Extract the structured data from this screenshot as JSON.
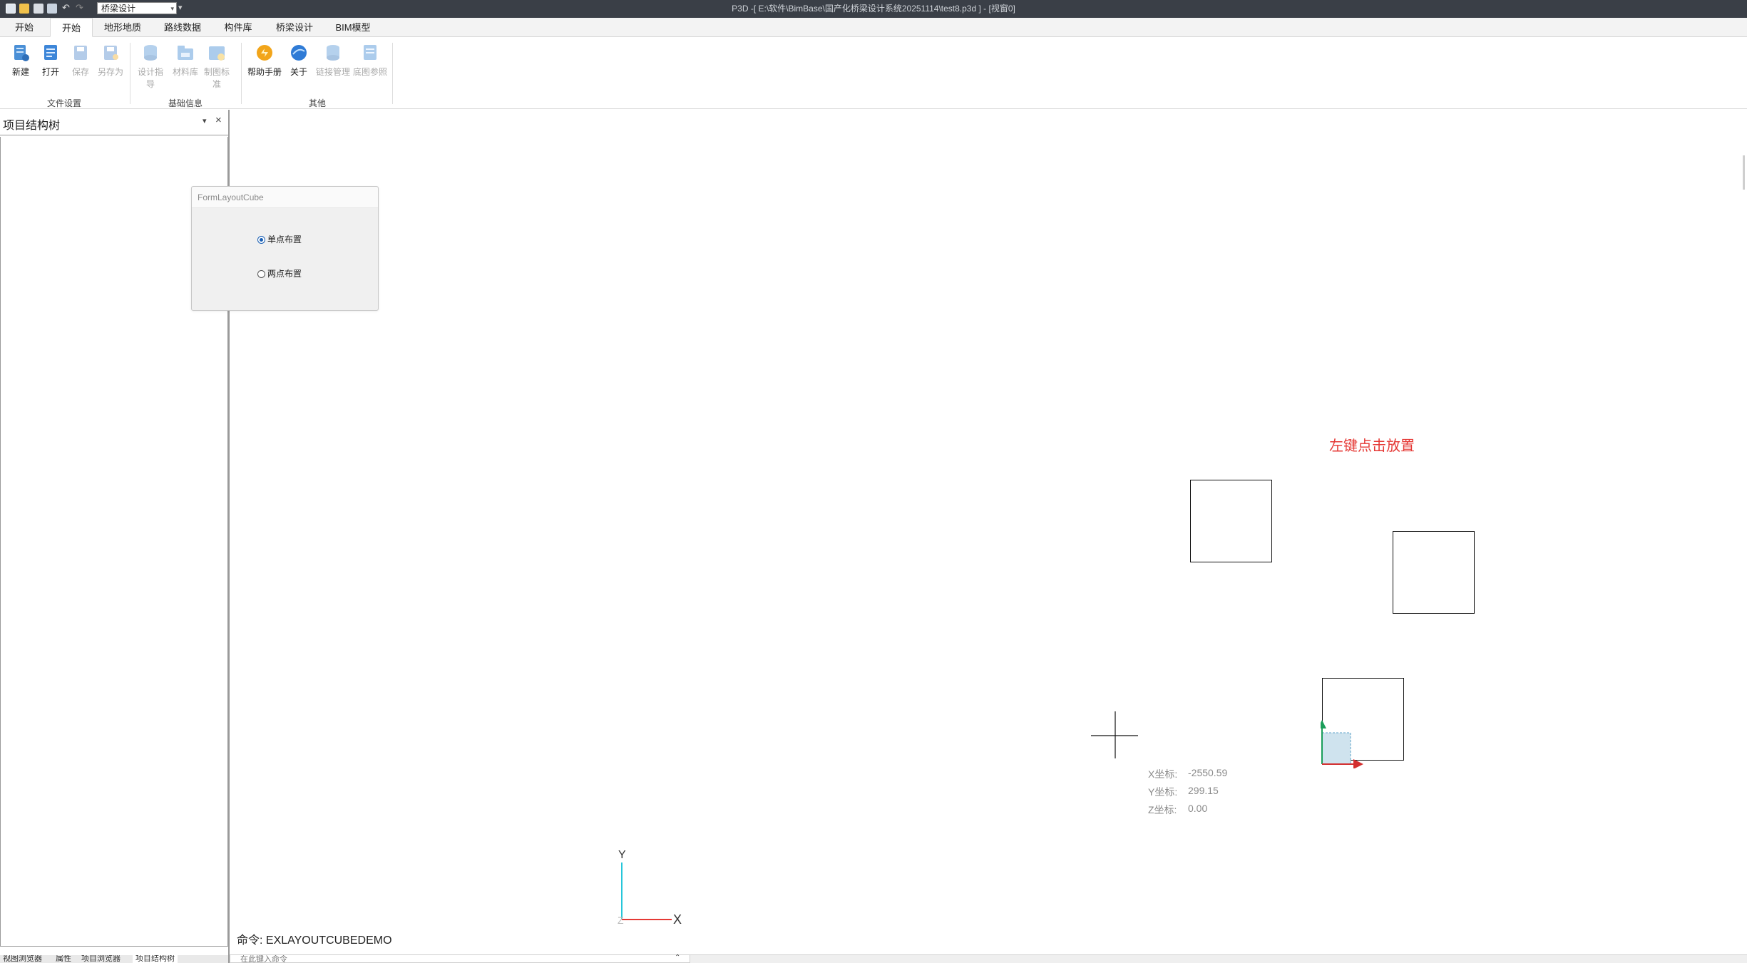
{
  "window": {
    "title": "P3D -[ E:\\软件\\BimBase\\国产化桥梁设计系统20251114\\test8.p3d ] - [视窗0]"
  },
  "quick_access": {
    "icons": [
      "new-file-icon",
      "open-folder-icon",
      "save-icon",
      "save-as-icon",
      "undo-icon",
      "redo-icon"
    ],
    "workspace_value": "桥梁设计",
    "more_symbol": "▾"
  },
  "ribbon": {
    "tabs": [
      {
        "label": "开始",
        "active": false
      },
      {
        "label": "开始",
        "active": true
      },
      {
        "label": "地形地质",
        "active": false
      },
      {
        "label": "路线数据",
        "active": false
      },
      {
        "label": "构件库",
        "active": false
      },
      {
        "label": "桥梁设计",
        "active": false
      },
      {
        "label": "BIM模型",
        "active": false
      }
    ],
    "groups": [
      {
        "label": "文件设置"
      },
      {
        "label": "基础信息"
      },
      {
        "label": "其他"
      }
    ],
    "buttons": [
      {
        "label": "新建",
        "icon": "new-document-icon",
        "enabled": true
      },
      {
        "label": "打开",
        "icon": "open-document-icon",
        "enabled": true
      },
      {
        "label": "保存",
        "icon": "save-icon",
        "enabled": false
      },
      {
        "label": "另存为",
        "icon": "save-as-icon",
        "enabled": false
      },
      {
        "label": "设计指导",
        "icon": "design-guide-icon",
        "enabled": false
      },
      {
        "label": "材料库",
        "icon": "material-library-icon",
        "enabled": false
      },
      {
        "label": "制图标准",
        "icon": "drawing-standard-icon",
        "enabled": false
      },
      {
        "label": "帮助手册",
        "icon": "help-manual-icon",
        "enabled": true
      },
      {
        "label": "关于",
        "icon": "about-icon",
        "enabled": true
      },
      {
        "label": "链接管理",
        "icon": "link-manager-icon",
        "enabled": false
      },
      {
        "label": "底图参照",
        "icon": "base-map-reference-icon",
        "enabled": false
      }
    ]
  },
  "left_panel": {
    "title": "项目结构树",
    "dropdown_symbol": "▾",
    "close_symbol": "×",
    "bottom_tabs": [
      {
        "label": "视图浏览器",
        "active": false
      },
      {
        "label": "属性",
        "active": false
      },
      {
        "label": "项目浏览器",
        "active": false
      },
      {
        "label": "项目结构树",
        "active": true
      }
    ]
  },
  "dialog": {
    "title": "FormLayoutCube",
    "options": [
      {
        "label": "单点布置",
        "selected": true
      },
      {
        "label": "两点布置",
        "selected": false
      }
    ]
  },
  "canvas": {
    "hint": "左键点击放置",
    "coordinates": {
      "x_label": "X坐标:",
      "x_value": "-2550.59",
      "y_label": "Y坐标:",
      "y_value": "299.15",
      "z_label": "Z坐标:",
      "z_value": "0.00"
    },
    "axis": {
      "y_label": "Y",
      "x_label": "X",
      "z_label": "Z",
      "x_color": "#e53935",
      "y_color": "#26c6da"
    }
  },
  "command": {
    "prompt": "命令: EXLAYOUTCUBEDEMO",
    "input_placeholder": "在此键入命令",
    "toggle_symbol": "⌃"
  },
  "colors": {
    "titlebar": "#3a3f47",
    "hint_red": "#e53935",
    "arrow_green": "#1b9e5a",
    "arrow_red": "#d32f2f",
    "preview_fill": "#cfe3ee"
  }
}
